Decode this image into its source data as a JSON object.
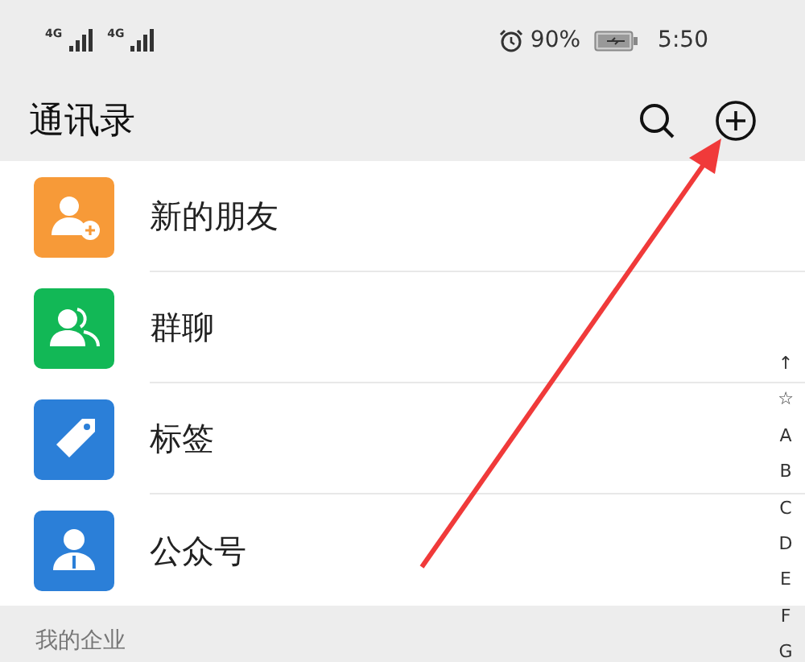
{
  "status_bar": {
    "signals": [
      "4G",
      "4G"
    ],
    "battery_percent": "90%",
    "time": "5:50"
  },
  "header": {
    "title": "通讯录"
  },
  "entries": [
    {
      "label": "新的朋友",
      "kind": "add-person",
      "color": "#f79a38"
    },
    {
      "label": "群聊",
      "kind": "group",
      "color": "#12b856"
    },
    {
      "label": "标签",
      "kind": "tag",
      "color": "#2b7fd8"
    },
    {
      "label": "公众号",
      "kind": "official",
      "color": "#2b7fd8"
    }
  ],
  "section": {
    "title": "我的企业"
  },
  "index_bar": [
    "↑",
    "☆",
    "A",
    "B",
    "C",
    "D",
    "E",
    "F",
    "G"
  ]
}
